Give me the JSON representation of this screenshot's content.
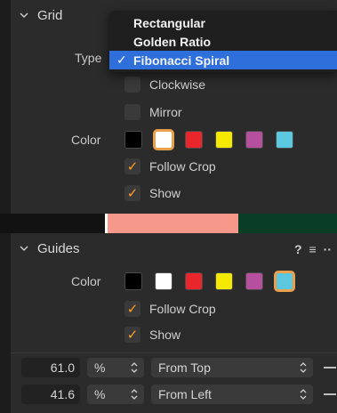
{
  "grid": {
    "title": "Grid",
    "type_label": "Type",
    "type_options": [
      "Rectangular",
      "Golden Ratio",
      "Fibonacci Spiral"
    ],
    "selected_type": "Fibonacci Spiral",
    "clockwise_label": "Clockwise",
    "mirror_label": "Mirror",
    "color_label": "Color",
    "colors": [
      "#000000",
      "#ffffff",
      "#e8262c",
      "#f5e900",
      "#b4509e",
      "#5cc8e0"
    ],
    "selected_color_index": 1,
    "follow_crop_label": "Follow Crop",
    "show_label": "Show"
  },
  "guides": {
    "title": "Guides",
    "help_label": "?",
    "menu_label": "≡",
    "more_label": "··",
    "color_label": "Color",
    "colors": [
      "#000000",
      "#ffffff",
      "#e8262c",
      "#f5e900",
      "#b4509e",
      "#5cc8e0"
    ],
    "selected_color_index": 5,
    "follow_crop_label": "Follow Crop",
    "show_label": "Show",
    "rows": [
      {
        "value": "61.0",
        "unit": "%",
        "anchor": "From Top"
      },
      {
        "value": "41.6",
        "unit": "%",
        "anchor": "From Left"
      }
    ]
  },
  "icons": {
    "collapse": "chevron-down-icon",
    "check": "checkmark-icon",
    "stepper": "up-down-arrows-icon"
  }
}
